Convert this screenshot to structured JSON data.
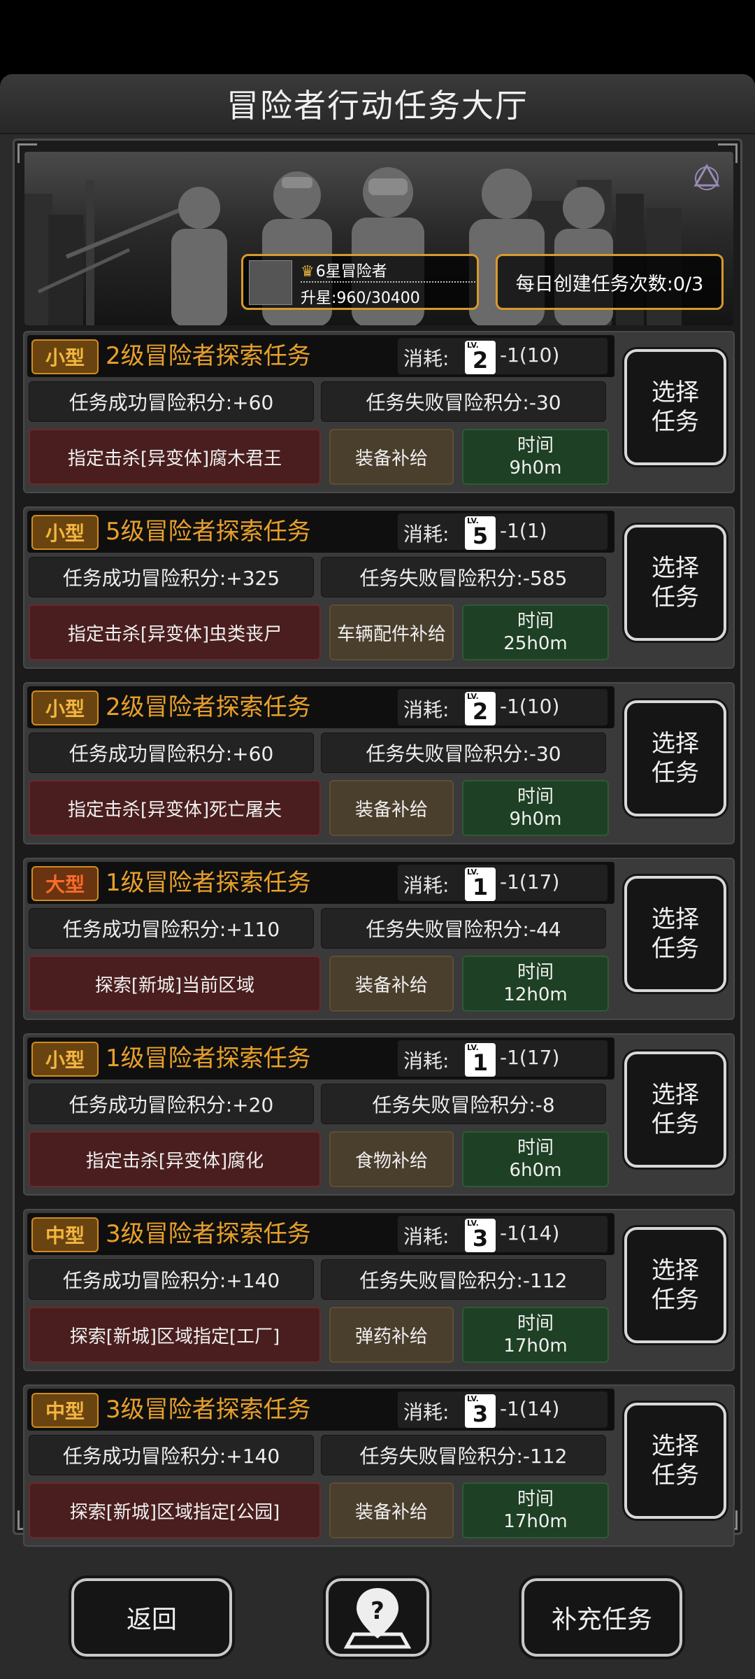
{
  "header": {
    "title": "冒险者行动任务大厅"
  },
  "banner": {
    "rank_name": "6星冒险者",
    "rank_progress": "升星:960/30400",
    "daily_create": "每日创建任务次数:0/3"
  },
  "tasks": [
    {
      "tag": "小型",
      "tag_type": "small",
      "title": "2级冒险者探索任务",
      "cost_label": "消耗:",
      "lv_badge": "LV.",
      "lv": "2",
      "cost": "-1(10)",
      "success": "任务成功冒险积分:+60",
      "fail": "任务失败冒险积分:-30",
      "objective": "指定击杀[异变体]腐木君王",
      "supply": "装备补给",
      "time_label": "时间",
      "time": "9h0m",
      "select": "选择任务"
    },
    {
      "tag": "小型",
      "tag_type": "small",
      "title": "5级冒险者探索任务",
      "cost_label": "消耗:",
      "lv_badge": "LV.",
      "lv": "5",
      "cost": "-1(1)",
      "success": "任务成功冒险积分:+325",
      "fail": "任务失败冒险积分:-585",
      "objective": "指定击杀[异变体]虫类丧尸",
      "supply": "车辆配件补给",
      "time_label": "时间",
      "time": "25h0m",
      "select": "选择任务"
    },
    {
      "tag": "小型",
      "tag_type": "small",
      "title": "2级冒险者探索任务",
      "cost_label": "消耗:",
      "lv_badge": "LV.",
      "lv": "2",
      "cost": "-1(10)",
      "success": "任务成功冒险积分:+60",
      "fail": "任务失败冒险积分:-30",
      "objective": "指定击杀[异变体]死亡屠夫",
      "supply": "装备补给",
      "time_label": "时间",
      "time": "9h0m",
      "select": "选择任务"
    },
    {
      "tag": "大型",
      "tag_type": "big",
      "title": "1级冒险者探索任务",
      "cost_label": "消耗:",
      "lv_badge": "LV.",
      "lv": "1",
      "cost": "-1(17)",
      "success": "任务成功冒险积分:+110",
      "fail": "任务失败冒险积分:-44",
      "objective": "探索[新城]当前区域",
      "supply": "装备补给",
      "time_label": "时间",
      "time": "12h0m",
      "select": "选择任务"
    },
    {
      "tag": "小型",
      "tag_type": "small",
      "title": "1级冒险者探索任务",
      "cost_label": "消耗:",
      "lv_badge": "LV.",
      "lv": "1",
      "cost": "-1(17)",
      "success": "任务成功冒险积分:+20",
      "fail": "任务失败冒险积分:-8",
      "objective": "指定击杀[异变体]腐化",
      "supply": "食物补给",
      "time_label": "时间",
      "time": "6h0m",
      "select": "选择任务"
    },
    {
      "tag": "中型",
      "tag_type": "mid",
      "title": "3级冒险者探索任务",
      "cost_label": "消耗:",
      "lv_badge": "LV.",
      "lv": "3",
      "cost": "-1(14)",
      "success": "任务成功冒险积分:+140",
      "fail": "任务失败冒险积分:-112",
      "objective": "探索[新城]区域指定[工厂]",
      "supply": "弹药补给",
      "time_label": "时间",
      "time": "17h0m",
      "select": "选择任务"
    },
    {
      "tag": "中型",
      "tag_type": "mid",
      "title": "3级冒险者探索任务",
      "cost_label": "消耗:",
      "lv_badge": "LV.",
      "lv": "3",
      "cost": "-1(14)",
      "success": "任务成功冒险积分:+140",
      "fail": "任务失败冒险积分:-112",
      "objective": "探索[新城]区域指定[公园]",
      "supply": "装备补给",
      "time_label": "时间",
      "time": "17h0m",
      "select": "选择任务"
    }
  ],
  "footer": {
    "back": "返回",
    "help_icon": "help-map-pin-icon",
    "refill": "补充任务"
  },
  "colors": {
    "accent_orange": "#e8a02a",
    "tag_big": "#ff6a2a",
    "objective_bg": "#4a1e1e",
    "supply_bg": "#4a3e2c",
    "time_bg": "#1e4024"
  }
}
